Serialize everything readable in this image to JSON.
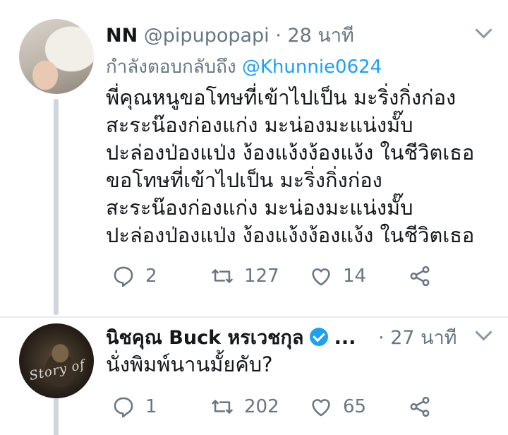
{
  "tweets": [
    {
      "name": "NN",
      "handle": "@pipupopapi",
      "sep": "·",
      "time": "28 นาที",
      "replying_label": "กำลังตอบกลับถึง",
      "replying_to": "@Khunnie0624",
      "text": "พี่คุณหนูขอโทษที่เข้าไปเป็น มะริ่งกิ่งก่อง\nสะระน๊องก่องแก่ง มะน่องมะแน่งมั๊บ\nปะล่องป่องแป่ง ง้องแง้งง้องแง้ง ในชีวิตเธอ\nขอโทษที่เข้าไปเป็น มะริ่งกิ่งก่อง\nสะระน๊องก่องแก่ง มะน่องมะแน่งมั๊บ\nปะล่องป่องแป่ง ง้องแง้งง้องแง้ง ในชีวิตเธอ",
      "replies": "2",
      "retweets": "127",
      "likes": "14"
    },
    {
      "name": "นิชคุณ Buck หรเวชกุล",
      "truncation": "...",
      "sep": "·",
      "time": "27 นาที",
      "text": "นั่งพิมพ์นานมั้ยคับ?",
      "replies": "1",
      "retweets": "202",
      "likes": "65",
      "avatar_script": "Story of"
    }
  ],
  "colors": {
    "accent": "#1da1f2",
    "muted": "#657786",
    "thread": "#cdd6dd"
  }
}
